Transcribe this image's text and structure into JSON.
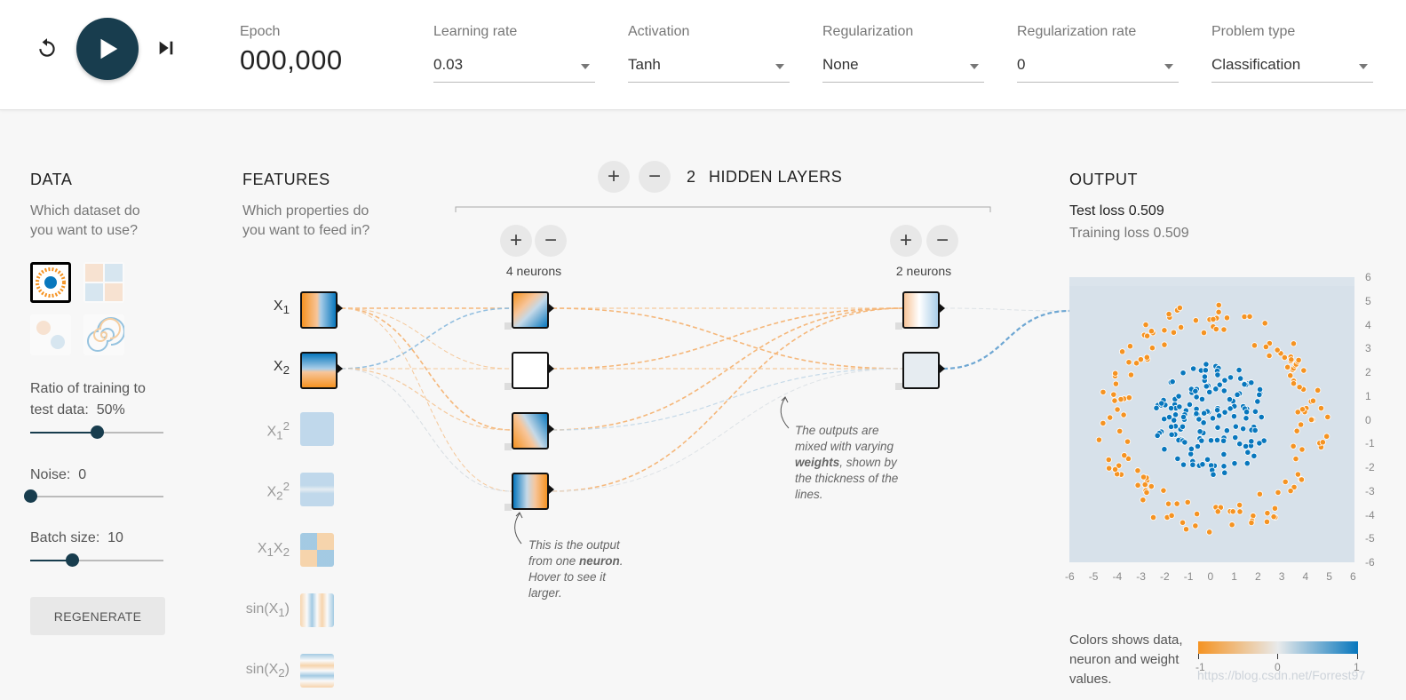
{
  "controls": {
    "reset_icon": "reset-icon",
    "play_icon": "play-icon",
    "step_icon": "step-forward-icon"
  },
  "epoch": {
    "label": "Epoch",
    "value": "000,000"
  },
  "settings": [
    {
      "label": "Learning rate",
      "value": "0.03"
    },
    {
      "label": "Activation",
      "value": "Tanh"
    },
    {
      "label": "Regularization",
      "value": "None"
    },
    {
      "label": "Regularization rate",
      "value": "0"
    },
    {
      "label": "Problem type",
      "value": "Classification"
    }
  ],
  "data_panel": {
    "title": "DATA",
    "subtitle": "Which dataset do you want to use?",
    "ratio_label": "Ratio of training to test data:",
    "ratio_value": "50%",
    "ratio_percent": 50,
    "noise_label": "Noise:",
    "noise_value": "0",
    "noise_level": 0,
    "batch_label": "Batch size:",
    "batch_value": "10",
    "batch_level": 10,
    "regenerate": "REGENERATE"
  },
  "features_panel": {
    "title": "FEATURES",
    "subtitle": "Which properties do you want to feed in?",
    "items": [
      {
        "name": "X1",
        "base": "X",
        "sub": "1",
        "sup": "",
        "active": true
      },
      {
        "name": "X2",
        "base": "X",
        "sub": "2",
        "sup": "",
        "active": true
      },
      {
        "name": "X1^2",
        "base": "X",
        "sub": "1",
        "sup": "2",
        "active": false
      },
      {
        "name": "X2^2",
        "base": "X",
        "sub": "2",
        "sup": "2",
        "active": false
      },
      {
        "name": "X1X2",
        "base": "X",
        "sub": "1",
        "sup": "",
        "active": false
      },
      {
        "name": "sin(X1)",
        "base": "sin(X",
        "sub": "1",
        "sup": "",
        "active": false
      },
      {
        "name": "sin(X2)",
        "base": "sin(X",
        "sub": "2",
        "sup": "",
        "active": false
      }
    ]
  },
  "hidden_layers": {
    "count": "2",
    "label": "HIDDEN LAYERS",
    "plus": "+",
    "minus": "−",
    "layers": [
      {
        "neurons_label": "4 neurons"
      },
      {
        "neurons_label": "2 neurons"
      }
    ]
  },
  "notes": {
    "outputs_mixed_a": "The outputs are mixed with varying",
    "outputs_mixed_b": "weights",
    "outputs_mixed_c": ", shown by the thickness of the lines.",
    "neuron_output_a": "This is the output from one",
    "neuron_output_b": "neuron",
    "neuron_output_c": ". Hover to see it larger."
  },
  "output_panel": {
    "title": "OUTPUT",
    "test_loss": "Test loss 0.509",
    "training_loss": "Training loss 0.509",
    "x_ticks": [
      "-6",
      "-5",
      "-4",
      "-3",
      "-2",
      "-1",
      "0",
      "1",
      "2",
      "3",
      "4",
      "5",
      "6"
    ],
    "y_ticks": [
      "6",
      "5",
      "4",
      "3",
      "2",
      "1",
      "0",
      "-1",
      "-2",
      "-3",
      "-4",
      "-5",
      "-6"
    ],
    "legend_text": "Colors shows data, neuron and weight values.",
    "legend_ticks": [
      "-1",
      "0",
      "1"
    ]
  },
  "colors": {
    "orange": "#f59322",
    "blue": "#0877bd",
    "dark": "#183d4e"
  },
  "watermark": "https://blog.csdn.net/Forrest97"
}
